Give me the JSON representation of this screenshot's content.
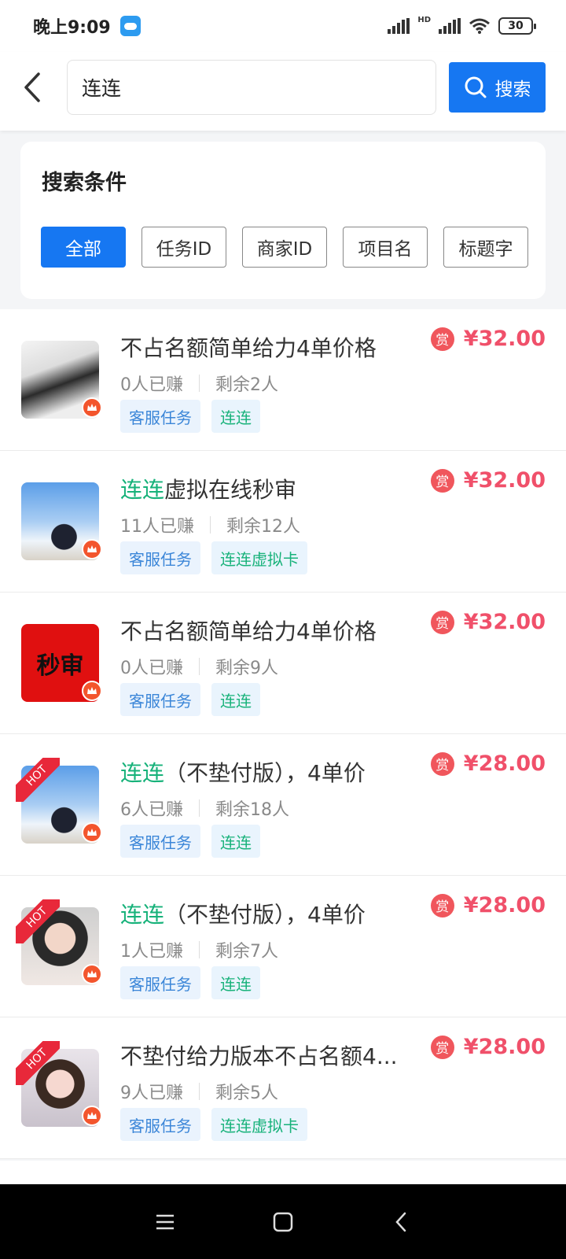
{
  "status_bar": {
    "time": "晚上9:09",
    "network": "HD",
    "battery": "30"
  },
  "search": {
    "value": "连连",
    "button_label": "搜索"
  },
  "filter": {
    "title": "搜索条件",
    "chips": [
      {
        "label": "全部",
        "active": true
      },
      {
        "label": "任务ID",
        "active": false
      },
      {
        "label": "商家ID",
        "active": false
      },
      {
        "label": "项目名",
        "active": false
      },
      {
        "label": "标题字",
        "active": false
      }
    ]
  },
  "tasks": [
    {
      "title_highlight": "",
      "title_rest": "不占名额简单给力4单价格",
      "earned": "0人已赚",
      "remaining": "剩余2人",
      "tags": [
        "客服任务",
        "连连"
      ],
      "price": "¥32.00",
      "reward_label": "赏",
      "hot": false,
      "thumb": "girl1"
    },
    {
      "title_highlight": "连连",
      "title_rest": "虚拟在线秒审",
      "earned": "11人已赚",
      "remaining": "剩余12人",
      "tags": [
        "客服任务",
        "连连虚拟卡"
      ],
      "price": "¥32.00",
      "reward_label": "赏",
      "hot": false,
      "thumb": "sky"
    },
    {
      "title_highlight": "",
      "title_rest": "不占名额简单给力4单价格",
      "earned": "0人已赚",
      "remaining": "剩余9人",
      "tags": [
        "客服任务",
        "连连"
      ],
      "price": "¥32.00",
      "reward_label": "赏",
      "hot": false,
      "thumb": "miaoshen",
      "thumb_text": "秒审"
    },
    {
      "title_highlight": "连连",
      "title_rest": "（不垫付版），4单价",
      "earned": "6人已赚",
      "remaining": "剩余18人",
      "tags": [
        "客服任务",
        "连连"
      ],
      "price": "¥28.00",
      "reward_label": "赏",
      "hot": true,
      "hot_label": "HOT",
      "thumb": "sky"
    },
    {
      "title_highlight": "连连",
      "title_rest": "（不垫付版），4单价",
      "earned": "1人已赚",
      "remaining": "剩余7人",
      "tags": [
        "客服任务",
        "连连"
      ],
      "price": "¥28.00",
      "reward_label": "赏",
      "hot": true,
      "hot_label": "HOT",
      "thumb": "girl2"
    },
    {
      "title_highlight": "",
      "title_rest": "不垫付给力版本不占名额4...",
      "earned": "9人已赚",
      "remaining": "剩余5人",
      "tags": [
        "客服任务",
        "连连虚拟卡"
      ],
      "price": "¥28.00",
      "reward_label": "赏",
      "hot": true,
      "hot_label": "HOT",
      "thumb": "girl3"
    }
  ],
  "colors": {
    "primary": "#1677f2",
    "highlight": "#17b27a",
    "price": "#f0506a",
    "tag_blue": "#3b86d8"
  }
}
